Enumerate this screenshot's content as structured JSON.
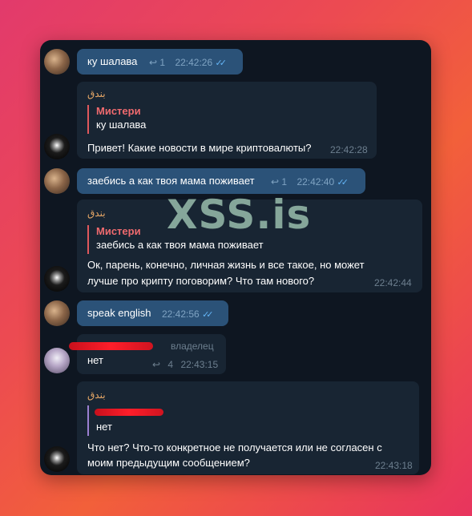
{
  "watermark": "XSS.is",
  "messages": [
    {
      "text": "ку шалава",
      "replies": "1",
      "time": "22:42:26"
    },
    {
      "sender": "بندق",
      "reply_name": "Мистери",
      "reply_text": "ку шалава",
      "text": "Привет! Какие новости в мире криптовалюты?",
      "time": "22:42:28"
    },
    {
      "text": "заебись а как твоя мама поживает",
      "replies": "1",
      "time": "22:42:40"
    },
    {
      "sender": "بندق",
      "reply_name": "Мистери",
      "reply_text": "заебись а как твоя мама поживает",
      "text_line1": "Ок, парень, конечно, личная жизнь и все такое, но может",
      "text_line2": "лучше про крипту поговорим? Что там нового?",
      "time": "22:42:44"
    },
    {
      "text": "speak english",
      "time": "22:42:56"
    },
    {
      "badge": "владелец",
      "text": "нет",
      "replies": "4",
      "time": "22:43:15"
    },
    {
      "sender": "بندق",
      "reply_text": "нет",
      "text_line1": "Что нет? Что-то конкретное не получается или не согласен с",
      "text_line2": "моим предыдущим сообщением?",
      "time": "22:43:18"
    }
  ],
  "icons": {
    "reply": "reply-arrow-icon",
    "read": "double-check-icon"
  },
  "colors": {
    "outgoing": "#2b5278",
    "incoming": "#182533",
    "background": "#0e1621",
    "sender": "#e6a766",
    "reply_name": "#ef6a6e"
  }
}
